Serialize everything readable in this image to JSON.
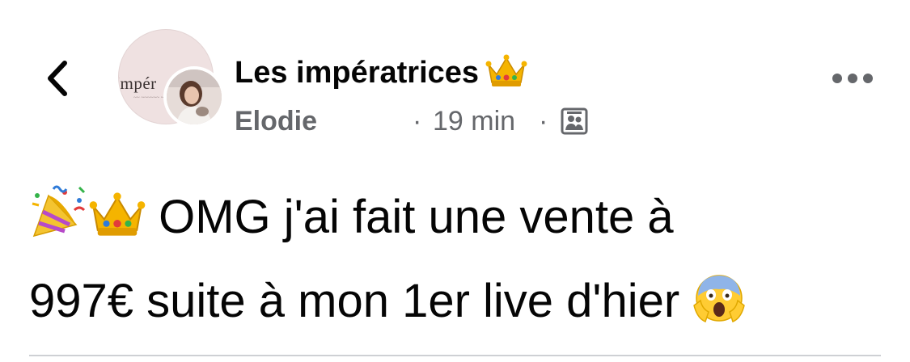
{
  "header": {
    "back_label": "Back",
    "group_name": "Les impératrices",
    "group_logo_text": "Impér",
    "author_name": "Elodie",
    "separator": "·",
    "timestamp": "19 min",
    "audience": "group-members-icon"
  },
  "post": {
    "text_line1": "OMG j'ai fait une vente à",
    "text_line2": "997€ suite à mon 1er live d'hier",
    "leading_emojis": [
      "party-popper-icon",
      "crown-icon"
    ],
    "trailing_emoji": "face-screaming-in-fear-icon"
  },
  "colors": {
    "primary_text": "#050505",
    "secondary_text": "#65676b",
    "divider": "#ced0d4",
    "avatar_bg": "#efe1e1",
    "crown_gold": "#f5b400",
    "scream_yellow": "#ffcc33"
  }
}
